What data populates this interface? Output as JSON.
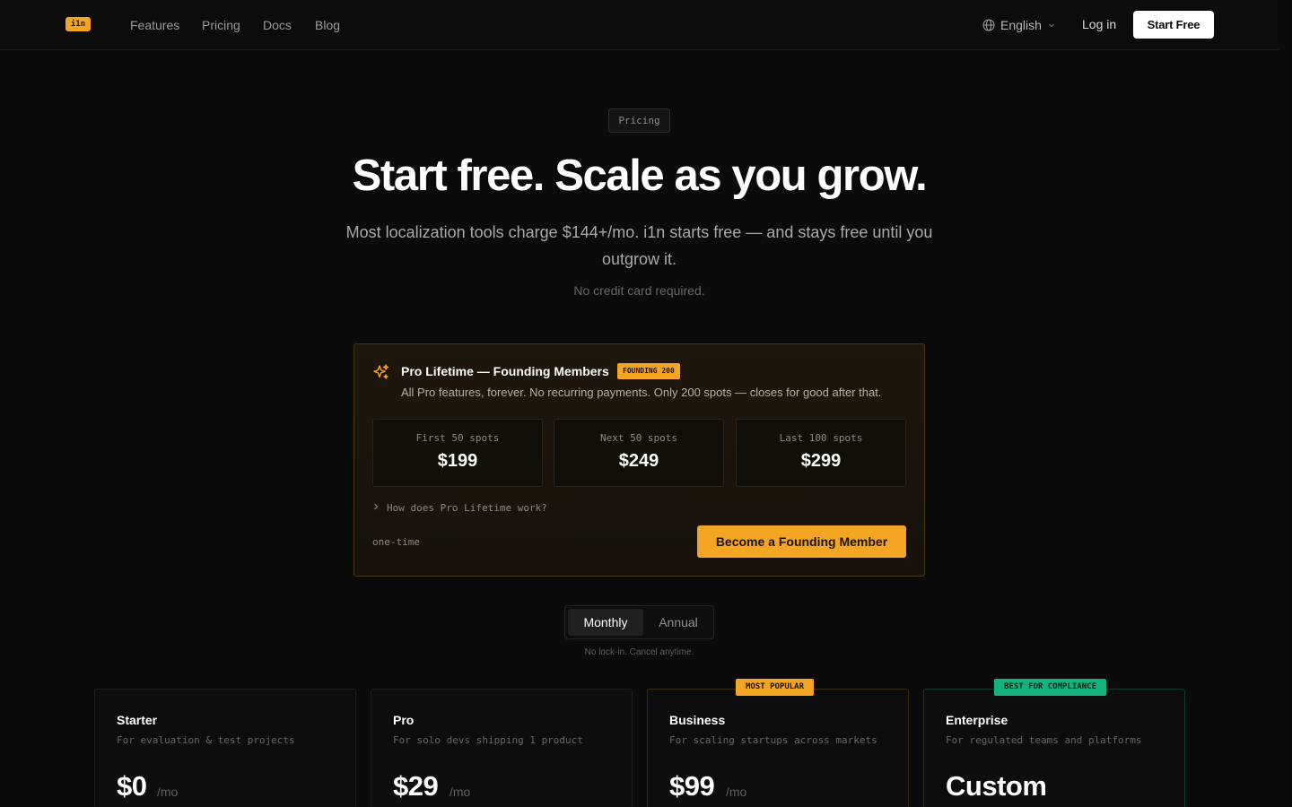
{
  "nav": {
    "logo": "i1n",
    "links": [
      "Features",
      "Pricing",
      "Docs",
      "Blog"
    ],
    "language": "English",
    "login": "Log in",
    "cta": "Start Free"
  },
  "hero": {
    "tag": "Pricing",
    "title": "Start free. Scale as you grow.",
    "subtitle": "Most localization tools charge $144+/mo. i1n starts free — and stays free until you outgrow it.",
    "note": "No credit card required."
  },
  "lifetime": {
    "title": "Pro Lifetime — Founding Members",
    "badge": "FOUNDING 200",
    "description": "All Pro features, forever. No recurring payments. Only 200 spots — closes for good after that.",
    "tiers": [
      {
        "label": "First 50 spots",
        "price": "$199"
      },
      {
        "label": "Next 50 spots",
        "price": "$249"
      },
      {
        "label": "Last 100 spots",
        "price": "$299"
      }
    ],
    "faq": "How does Pro Lifetime work?",
    "footnote": "one-time",
    "cta": "Become a Founding Member"
  },
  "billing": {
    "options": [
      "Monthly",
      "Annual"
    ],
    "selected": "Monthly",
    "note": "No lock-in. Cancel anytime."
  },
  "plans": [
    {
      "name": "Starter",
      "description": "For evaluation & test projects",
      "price": "$0",
      "period": "/mo",
      "badge": ""
    },
    {
      "name": "Pro",
      "description": "For solo devs shipping 1 product",
      "price": "$29",
      "period": "/mo",
      "badge": ""
    },
    {
      "name": "Business",
      "description": "For scaling startups across markets",
      "price": "$99",
      "period": "/mo",
      "badge": "MOST POPULAR"
    },
    {
      "name": "Enterprise",
      "description": "For regulated teams and platforms",
      "price": "Custom",
      "period": "",
      "badge": "BEST FOR COMPLIANCE"
    }
  ],
  "colors": {
    "accent": "#f5a524",
    "compliance": "#14b37d",
    "background": "#0b0b0c"
  },
  "icons": [
    "globe-icon",
    "chevron-down-icon",
    "sparkles-icon",
    "chevron-right-icon"
  ]
}
